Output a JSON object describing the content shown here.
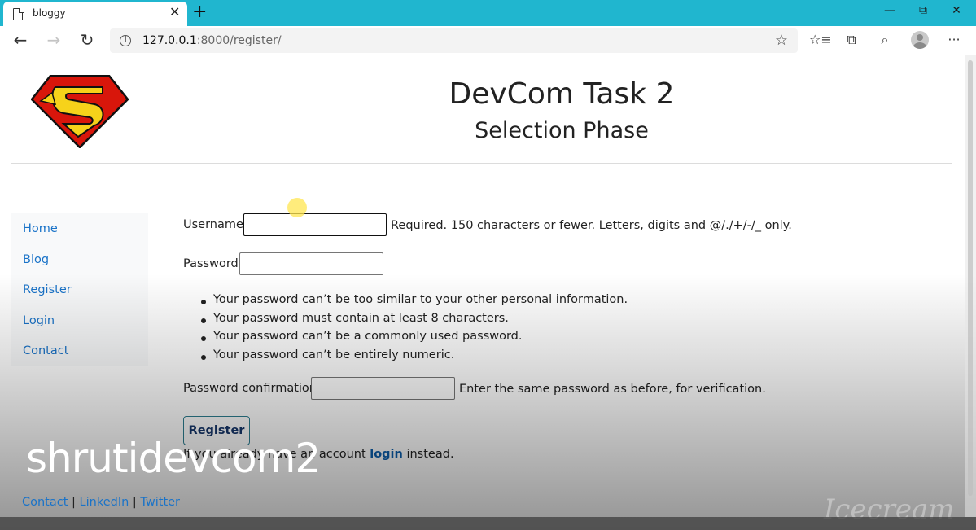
{
  "browser": {
    "tab_title": "bloggy",
    "tab_close": "✕",
    "new_tab": "+",
    "window_controls": {
      "minimize": "—",
      "restore": "⧉",
      "close": "✕"
    },
    "nav": {
      "back": "←",
      "forward": "→",
      "reload": "↻"
    },
    "url_host": "127.0.0.1",
    "url_path": ":8000/register/",
    "favorite_glyph": "☆",
    "toolbar_glyphs": {
      "favorites": "☆≡",
      "collections": "⧉",
      "feedback": "⌕",
      "more": "···"
    }
  },
  "header": {
    "title": "DevCom Task 2",
    "subtitle": "Selection Phase",
    "logo_colors": {
      "red": "#d8160b",
      "yellow": "#f6d21a",
      "outline": "#111111"
    }
  },
  "sidebar": {
    "items": [
      {
        "label": "Home"
      },
      {
        "label": "Blog"
      },
      {
        "label": "Register"
      },
      {
        "label": "Login"
      },
      {
        "label": "Contact"
      }
    ]
  },
  "form": {
    "username_label": "Username:",
    "username_help": "Required. 150 characters or fewer. Letters, digits and @/./+/-/_ only.",
    "password_label": "Password:",
    "password_rules": [
      "Your password can’t be too similar to your other personal information.",
      "Your password must contain at least 8 characters.",
      "Your password can’t be a commonly used password.",
      "Your password can’t be entirely numeric."
    ],
    "confirm_label": "Password confirmation:",
    "confirm_help": "Enter the same password as before, for verification.",
    "submit_label": "Register",
    "already_prefix": "If you already have an account",
    "login_link": "login",
    "already_suffix": "instead."
  },
  "footer": {
    "links": [
      "Contact",
      "LinkedIn",
      "Twitter"
    ],
    "separator": "|"
  },
  "overlay": {
    "caption": "shrutidevcom2",
    "watermark": "Icecream"
  }
}
